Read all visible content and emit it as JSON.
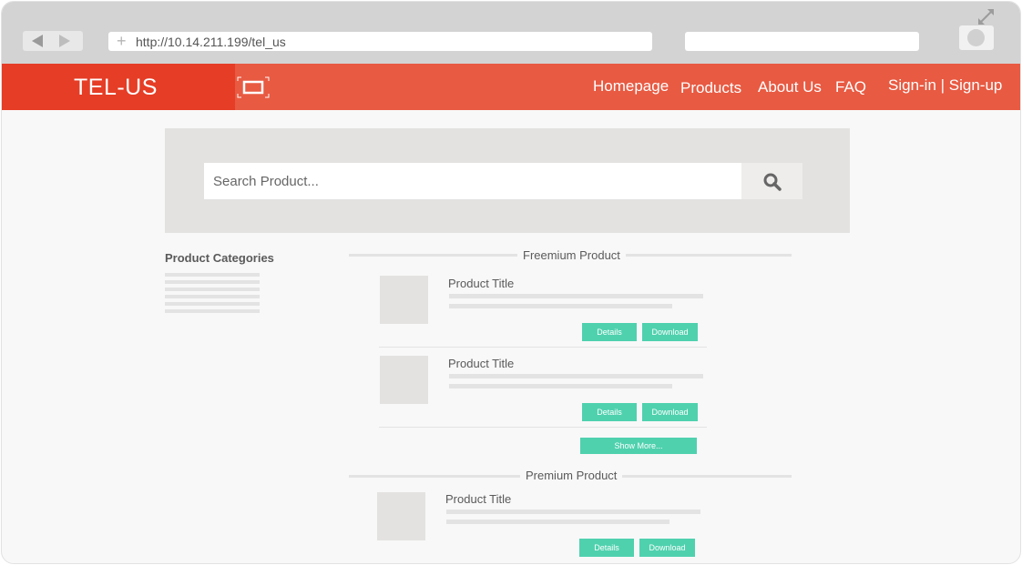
{
  "browser": {
    "url": "http://10.14.211.199/tel_us",
    "plus_glyph": "+"
  },
  "header": {
    "brand": "TEL-US",
    "nav": [
      "Homepage",
      "Products",
      "About Us",
      "FAQ",
      "Sign-in | Sign-up"
    ]
  },
  "search": {
    "placeholder": "Search Product..."
  },
  "sidebar": {
    "heading": "Product Categories"
  },
  "freemium": {
    "heading": "Freemium Product",
    "items": [
      {
        "title": "Product Title",
        "details_label": "Details",
        "download_label": "Download"
      },
      {
        "title": "Product Title",
        "details_label": "Details",
        "download_label": "Download"
      }
    ],
    "show_more_label": "Show More..."
  },
  "premium": {
    "heading": "Premium Product",
    "items": [
      {
        "title": "Product Title",
        "details_label": "Details",
        "download_label": "Download"
      }
    ]
  },
  "colors": {
    "header": "#e85a42",
    "brand": "#e53d26",
    "button": "#4fd1ae"
  }
}
